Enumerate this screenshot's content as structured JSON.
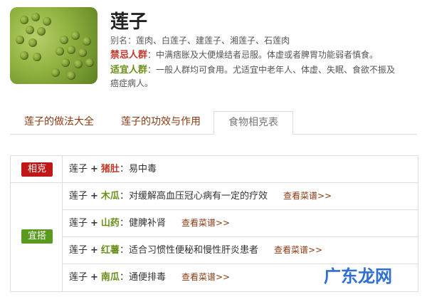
{
  "header": {
    "title": "莲子",
    "alias_label": "别名：",
    "alias": "莲肉、白莲子、建莲子、湘莲子、石莲肉",
    "taboo_label": "禁忌人群",
    "taboo": "：中满痞胀及大便燥结者忌服。体虚或者脾胃功能弱者慎食。",
    "suitable_label": "适宜人群",
    "suitable_line1": "：一般人群均可食用。尤适宜中老年人、体虚、失眠、食欲不振及",
    "suitable_line2": "癌症病人。"
  },
  "tabs": [
    {
      "label": "莲子的做法大全"
    },
    {
      "label": "莲子的功效与作用"
    },
    {
      "label": "食物相克表"
    }
  ],
  "table": {
    "conflict_badge": "相克",
    "suitable_badge": "宜搭",
    "link_label": "查看菜谱>>",
    "rows": [
      {
        "name": "莲子",
        "plus": "+",
        "food": "猪肚",
        "effect": "：易中毒"
      },
      {
        "name": "莲子",
        "plus": "+",
        "food": "木瓜",
        "effect": "：对缓解高血压冠心病有一定的疗效"
      },
      {
        "name": "莲子",
        "plus": "+",
        "food": "山药",
        "effect": "：健脾补肾"
      },
      {
        "name": "莲子",
        "plus": "+",
        "food": "红薯",
        "effect": "：适合习惯性便秘和慢性肝炎患者"
      },
      {
        "name": "莲子",
        "plus": "+",
        "food": "南瓜",
        "effect": "：通便排毒"
      }
    ]
  },
  "watermark": "广东龙网",
  "colors": {
    "conflict": "#c01818",
    "suitable": "#5a9a1e",
    "link": "#8a3a12",
    "watermark": "#2f6fd0"
  }
}
